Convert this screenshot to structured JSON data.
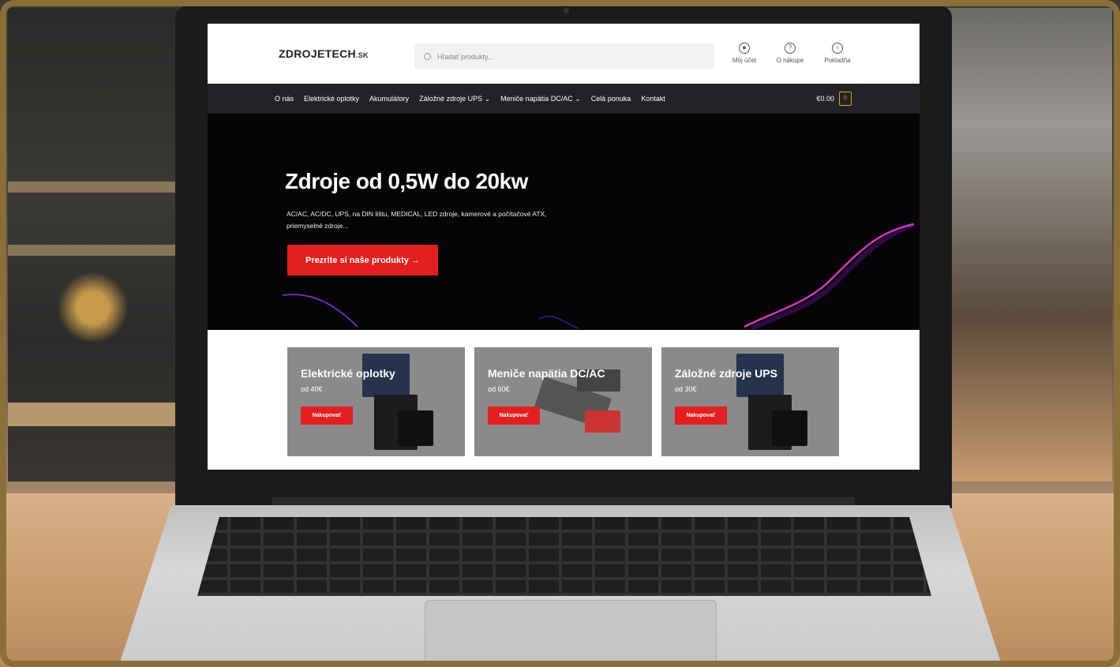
{
  "site": {
    "logo": "ZDROJETECH",
    "logo_tld": ".SK",
    "search_placeholder": "Hľadať produkty...",
    "header_icons": [
      {
        "name": "user-icon",
        "label": "Môj účet"
      },
      {
        "name": "help-icon",
        "label": "O nákupe"
      },
      {
        "name": "checkout-icon",
        "label": "Pokladňa"
      }
    ]
  },
  "nav": {
    "items": [
      {
        "label": "O nás"
      },
      {
        "label": "Elektrické oplotky"
      },
      {
        "label": "Akumulátory"
      },
      {
        "label": "Záložné zdroje UPS ⌄"
      },
      {
        "label": "Meniče napätia DC/AC ⌄"
      },
      {
        "label": "Celá ponuka"
      },
      {
        "label": "Kontakt"
      }
    ],
    "cart_total": "€0.00",
    "cart_count": "0"
  },
  "hero": {
    "title": "Zdroje od 0,5W do 20kw",
    "subtitle": "AC/AC, AC/DC, UPS, na DIN lištu, MEDICAL, LED zdroje, kamerové a počítačové ATX, priemyselné zdroje...",
    "cta": "Prezrite si naše produkty →"
  },
  "categories": [
    {
      "title": "Elektrické oplotky",
      "price": "od 40€",
      "button": "Nakupovať"
    },
    {
      "title": "Meniče napätia DC/AC",
      "price": "od 60€",
      "button": "Nakupovať"
    },
    {
      "title": "Záložné zdroje UPS",
      "price": "od 30€",
      "button": "Nakupovať"
    }
  ],
  "colors": {
    "accent_red": "#e41f1f",
    "nav_bg": "#222326",
    "cart_accent": "#e4a11b",
    "frame_gold": "#8a6f3a"
  }
}
